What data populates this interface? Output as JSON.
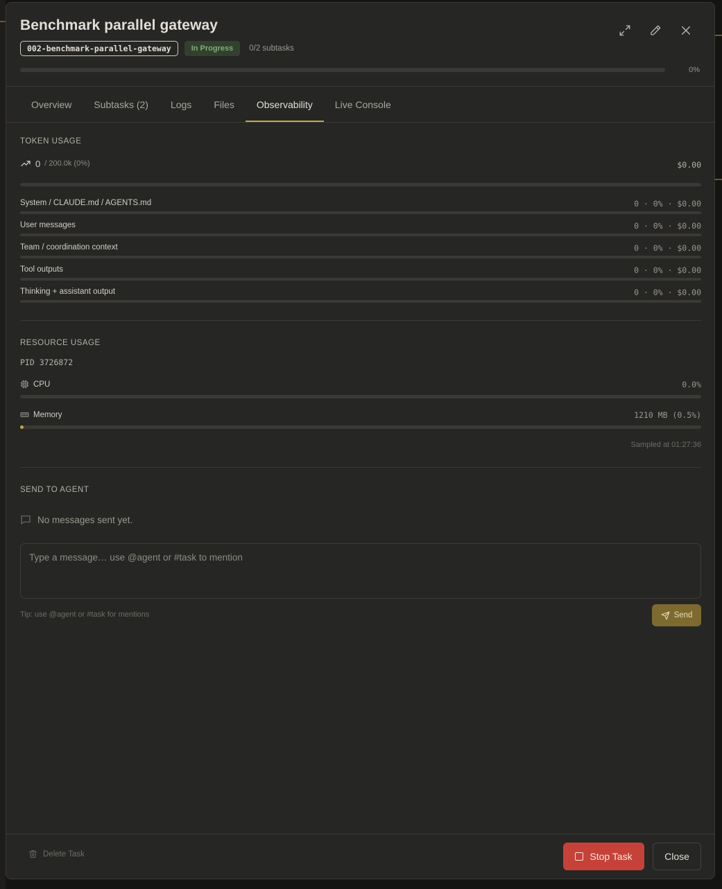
{
  "task": {
    "title": "Benchmark parallel gateway",
    "spec_id": "002-benchmark-parallel-gateway",
    "status": "In Progress",
    "subtasks_label": "0/2 subtasks",
    "progress_pct": 0,
    "progress_label": "0%"
  },
  "tabs": [
    {
      "label": "Overview"
    },
    {
      "label": "Subtasks (2)"
    },
    {
      "label": "Logs"
    },
    {
      "label": "Files"
    },
    {
      "label": "Observability"
    },
    {
      "label": "Live Console"
    }
  ],
  "active_tab": "Observability",
  "token_usage": {
    "title": "TOKEN USAGE",
    "total": "0",
    "limit_label": "/ 200.0k (0%)",
    "cost": "$0.00",
    "fraction": 0,
    "rows": [
      {
        "label": "System / CLAUDE.md / AGENTS.md",
        "value": "0 · 0% · $0.00",
        "fraction": 0
      },
      {
        "label": "User messages",
        "value": "0 · 0% · $0.00",
        "fraction": 0
      },
      {
        "label": "Team / coordination context",
        "value": "0 · 0% · $0.00",
        "fraction": 0
      },
      {
        "label": "Tool outputs",
        "value": "0 · 0% · $0.00",
        "fraction": 0
      },
      {
        "label": "Thinking + assistant output",
        "value": "0 · 0% · $0.00",
        "fraction": 0
      }
    ]
  },
  "resource_usage": {
    "title": "RESOURCE USAGE",
    "pid": "PID 3726872",
    "cpu_label": "CPU",
    "cpu_value": "0.0%",
    "cpu_fraction": 0,
    "memory_label": "Memory",
    "memory_value": "1210 MB (0.5%)",
    "memory_fraction": 0.005,
    "sampled": "Sampled at 01:27:36"
  },
  "send_to_agent": {
    "title": "SEND TO AGENT",
    "empty_text": "No messages sent yet.",
    "placeholder": "Type a message… use @agent or #task to mention",
    "tip": "Tip: use @agent or #task for mentions",
    "send_label": "Send"
  },
  "footer": {
    "delete_label": "Delete Task",
    "stop_label": "Stop Task",
    "close_label": "Close"
  },
  "colors": {
    "accent": "#c9a640",
    "danger": "#c64238",
    "success": "#7fae77",
    "background": "#262624"
  }
}
